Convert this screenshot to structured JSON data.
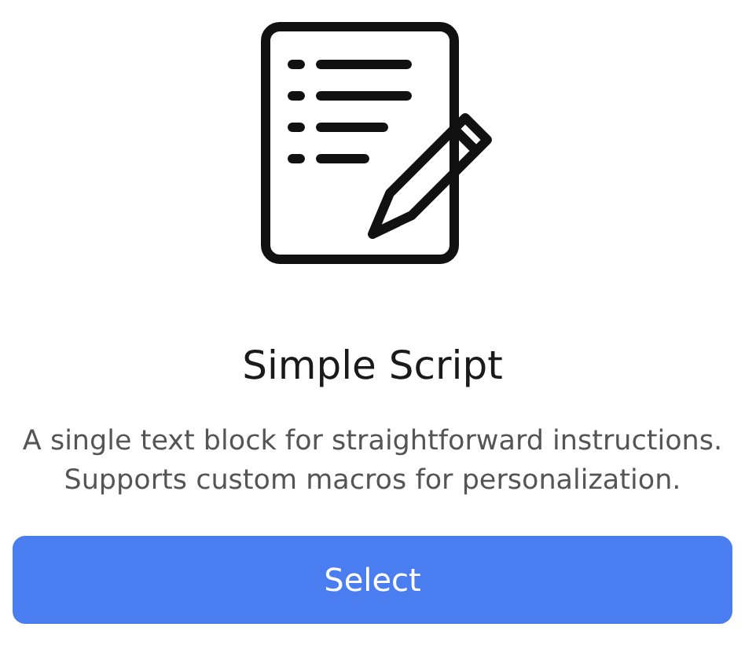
{
  "card": {
    "title": "Simple Script",
    "description": "A single text block for straightforward instructions. Supports custom macros for personalization.",
    "button": "Select"
  }
}
